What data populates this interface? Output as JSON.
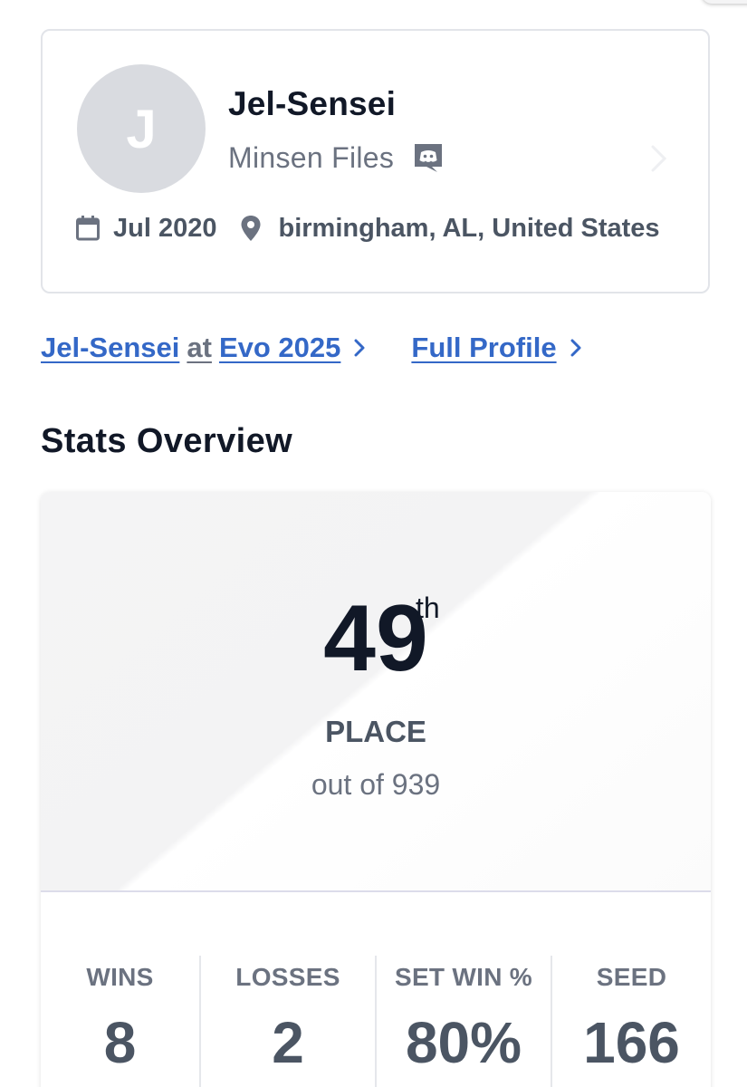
{
  "profile": {
    "avatar_initial": "J",
    "gamer_tag": "Jel-Sensei",
    "team": "Minsen Files",
    "discord_icon": "discord-icon",
    "joined": "Jul 2020",
    "location": "birmingham, AL, United States"
  },
  "links": {
    "player_link": "Jel-Sensei",
    "at_text": "at",
    "event_link": "Evo 2025",
    "full_profile": "Full Profile"
  },
  "stats": {
    "section_title": "Stats Overview",
    "place": "49",
    "place_suffix": "th",
    "place_label": "PLACE",
    "out_of": "out of 939",
    "columns": [
      {
        "label": "WINS",
        "value": "8"
      },
      {
        "label": "LOSSES",
        "value": "2"
      },
      {
        "label": "SET WIN %",
        "value": "80%"
      },
      {
        "label": "SEED",
        "value": "166"
      }
    ]
  },
  "colors": {
    "link": "#3468c7",
    "text_dark": "#111827",
    "text_muted": "#6b7280"
  }
}
